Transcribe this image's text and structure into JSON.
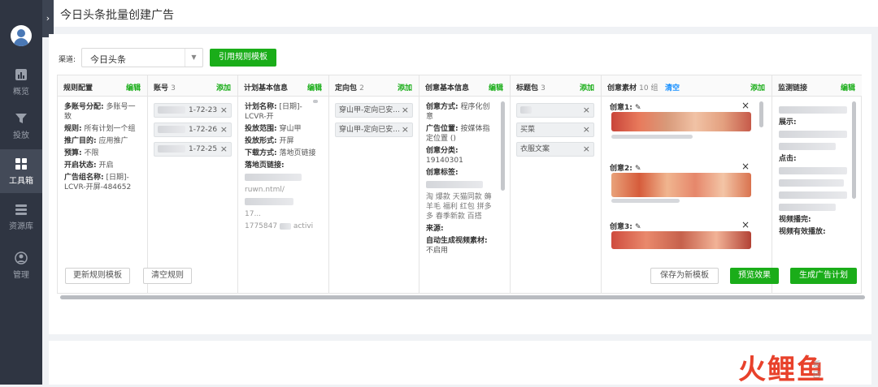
{
  "sidebar": {
    "toggle": "›",
    "items": [
      {
        "label": "概览",
        "icon": "chart-icon"
      },
      {
        "label": "投放",
        "icon": "funnel-icon"
      },
      {
        "label": "工具箱",
        "icon": "grid-icon"
      },
      {
        "label": "资源库",
        "icon": "database-icon"
      },
      {
        "label": "管理",
        "icon": "user-circle-icon"
      }
    ]
  },
  "page": {
    "title": "今日头条批量创建广告"
  },
  "channel": {
    "label": "渠道:",
    "value": "今日头条",
    "arrow": "▼"
  },
  "buttons": {
    "apply_template": "引用规则模板",
    "update_template": "更新规则模板",
    "clear_rules": "清空规则",
    "save_new_template": "保存为新模板",
    "preview": "预览效果",
    "generate": "生成广告计划"
  },
  "columns": {
    "rule": {
      "title": "规则配置",
      "action": "编辑"
    },
    "account": {
      "title": "账号",
      "count": "3",
      "action": "添加"
    },
    "plan": {
      "title": "计划基本信息",
      "action": "编辑"
    },
    "targeting": {
      "title": "定向包",
      "count": "2",
      "action": "添加"
    },
    "creative": {
      "title": "创意基本信息",
      "action": "编辑"
    },
    "titles": {
      "title": "标题包",
      "count": "3",
      "action": "添加"
    },
    "material": {
      "title": "创意素材",
      "count": "10 组",
      "clear": "清空",
      "action": "添加"
    },
    "monitor": {
      "title": "监测链接",
      "action": "编辑"
    }
  },
  "rule": [
    {
      "k": "多账号分配:",
      "v": "多账号一致"
    },
    {
      "k": "规则:",
      "v": "所有计划一个组"
    },
    {
      "k": "推广目的:",
      "v": "应用推广"
    },
    {
      "k": "预算:",
      "v": "不限"
    },
    {
      "k": "开启状态:",
      "v": "开启"
    },
    {
      "k": "广告组名称:",
      "v": "[日期]-LCVR-开屏-484652"
    }
  ],
  "accounts": [
    "1-72-23",
    "1-72-26",
    "1-72-25"
  ],
  "plan": [
    {
      "k": "计划名称:",
      "v": "[日期]-LCVR-开"
    },
    {
      "k": "投放范围:",
      "v": "穿山甲"
    },
    {
      "k": "投放形式:",
      "v": "开屏"
    },
    {
      "k": "下载方式:",
      "v": "落地页链接"
    },
    {
      "k": "落地页链接:",
      "v": ""
    }
  ],
  "plan_extra": {
    "line1": "ruwn.ntml/",
    "line2": "17...",
    "line3": "1775847",
    "line4": "activi"
  },
  "targeting": [
    "穿山甲-定向已安...",
    "穿山甲-定向已安..."
  ],
  "creative": [
    {
      "k": "创意方式:",
      "v": "程序化创意"
    },
    {
      "k": "广告位置:",
      "v": "按媒体指定位置 ()"
    },
    {
      "k": "创意分类:",
      "v": "19140301"
    },
    {
      "k": "创意标签:",
      "v": ""
    }
  ],
  "creative_tags": "淘 爆款 天猫同款 薅羊毛 福利 红包 拼多多 春季新款 百搭",
  "creative_more": [
    {
      "k": "来源:",
      "v": ""
    },
    {
      "k": "自动生成视频素材:",
      "v": "不启用"
    }
  ],
  "title_packs": [
    "",
    "买菜",
    "衣服文案"
  ],
  "materials": [
    "创意1:",
    "创意2:",
    "创意3:"
  ],
  "monitor": [
    {
      "k": "展示:",
      "v": ""
    },
    {
      "k": "点击:",
      "v": ""
    },
    {
      "k": "视频播完:",
      "v": ""
    },
    {
      "k": "视频有效播放:",
      "v": ""
    }
  ],
  "icons": {
    "close": "×",
    "edit": "✎"
  },
  "watermark": {
    "chars": [
      "火",
      "鲤",
      "鱼"
    ],
    "colors": [
      "#e8412b",
      "#e8412b",
      "#e8412b"
    ],
    "small": "返回"
  }
}
